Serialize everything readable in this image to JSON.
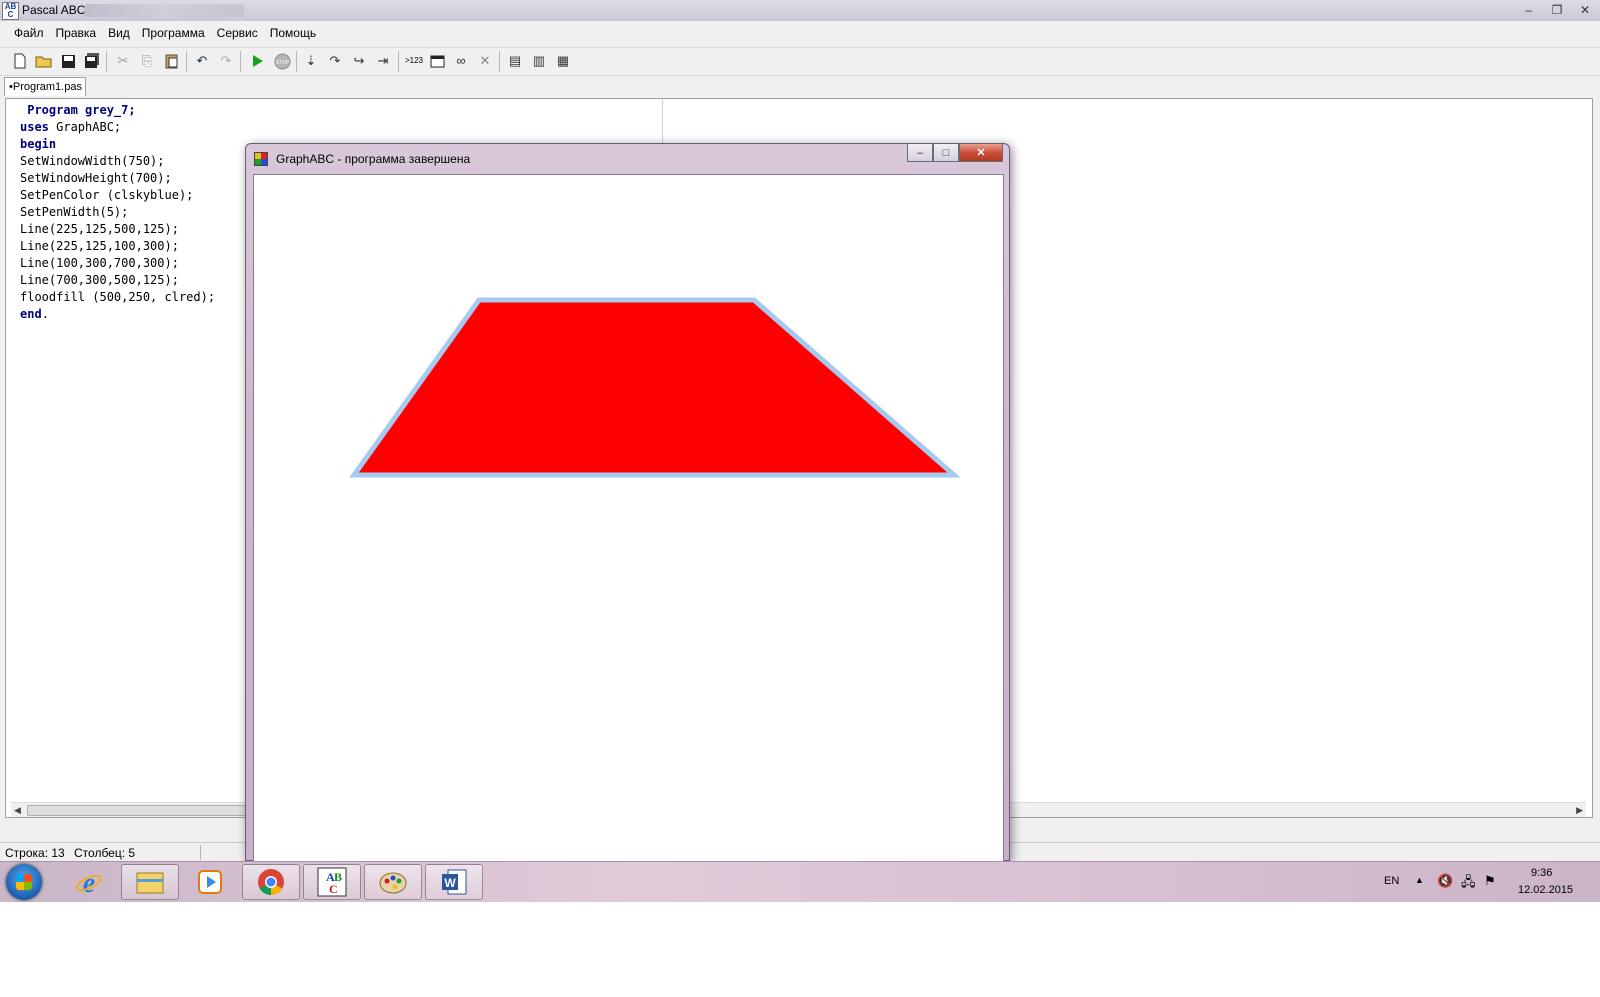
{
  "window": {
    "title": "Pascal ABC"
  },
  "menu": [
    "Файл",
    "Правка",
    "Вид",
    "Программа",
    "Сервис",
    "Помощь"
  ],
  "tab": {
    "label": "•Program1.pas"
  },
  "code": [
    " Program grey_7;",
    "uses GraphABC;",
    "begin",
    "SetWindowWidth(750);",
    "SetWindowHeight(700);",
    "SetPenColor (clskyblue);",
    "SetPenWidth(5);",
    "Line(225,125,500,125);",
    "Line(225,125,100,300);",
    "Line(100,300,700,300);",
    "Line(700,300,500,125);",
    "floodfill (500,250, clred);",
    "end."
  ],
  "status": {
    "row": "Строка: 13",
    "col": "Столбец: 5"
  },
  "graph_window": {
    "title": "GraphABC - программа завершена",
    "fill_color": "#ff0000",
    "pen_color": "#a6caf0"
  },
  "taskbar": {
    "lang": "EN",
    "time": "9:36",
    "date": "12.02.2015",
    "apps": [
      "start-button",
      "ie-icon",
      "explorer-icon",
      "media-player-icon",
      "chrome-icon",
      "pascal-abc-icon",
      "paint-icon",
      "word-icon"
    ]
  }
}
